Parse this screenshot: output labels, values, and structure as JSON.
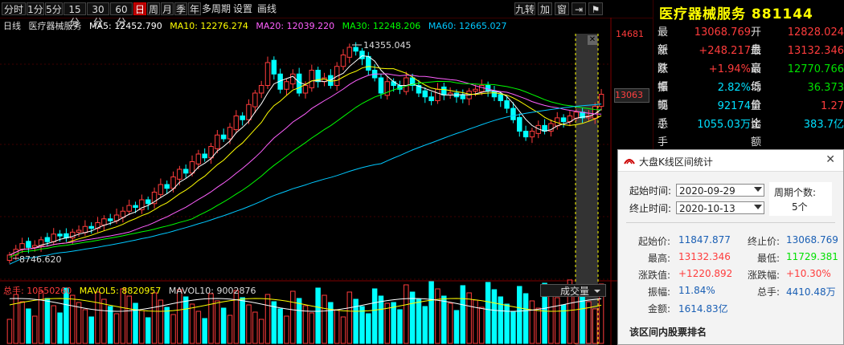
{
  "toolbar": {
    "periods": [
      "分时",
      "1分",
      "5分",
      "15分",
      "30分",
      "60分",
      "日",
      "周",
      "月",
      "季",
      "年",
      "多周期",
      "设置",
      "画线"
    ],
    "active": "日",
    "right_buttons": [
      "九转",
      "加",
      "窗",
      "⇥",
      "⚑"
    ]
  },
  "chart": {
    "ma_header": {
      "label": "日线",
      "name": "医疗器械服务",
      "ma5": "MA5: 12452.790",
      "ma10": "MA10: 12276.274",
      "ma20": "MA20: 12039.220",
      "ma30": "MA30: 12248.206",
      "ma60": "MA60: 12665.027"
    },
    "high_label": "14355.045",
    "low_label": "8746.620",
    "axis_top": "14681",
    "current_price": "13063",
    "vol_header": {
      "total": "总手: 10550260",
      "mavol5": "MAVOL5: 8820957",
      "mavol10": "MAVOL10: 9002876"
    },
    "turnover_tab": "成交量",
    "colors": {
      "ma5": "#ffffff",
      "ma10": "#ffff00",
      "ma20": "#ff60ff",
      "ma30": "#00ff00",
      "ma60": "#00c8ff",
      "up": "#ff3c3c",
      "down": "#00ffff"
    }
  },
  "chart_data": {
    "type": "candlestick",
    "closes": [
      8850,
      9000,
      9150,
      9050,
      9100,
      9250,
      9200,
      9400,
      9350,
      9300,
      9450,
      9500,
      9600,
      9550,
      9700,
      9800,
      9750,
      9900,
      10000,
      10150,
      10100,
      10300,
      10200,
      10500,
      10700,
      10600,
      10900,
      11100,
      11000,
      11300,
      11500,
      11400,
      11700,
      12000,
      11900,
      12200,
      12500,
      12400,
      12800,
      13100,
      13300,
      13900,
      13600,
      13200,
      13400,
      13600,
      13100,
      13300,
      13700,
      13400,
      13500,
      13300,
      13800,
      14100,
      14300,
      14200,
      14000,
      13700,
      13500,
      13100,
      13400,
      13300,
      13200,
      13500,
      13300,
      13100,
      13000,
      12900,
      13200,
      13050,
      13100,
      13000,
      12950,
      13150,
      13200,
      13300,
      13150,
      13000,
      12900,
      12700,
      12400,
      12100,
      11950,
      12100,
      12250,
      12100,
      12300,
      12450,
      12350,
      12500,
      12600,
      12450,
      12500,
      12750,
      13069
    ],
    "high": "14355.045",
    "low": "8746.620"
  },
  "quote": {
    "title": "医疗器械服务 881144",
    "rows": [
      {
        "l1": "最新",
        "v1": "13068.769",
        "c1": "red",
        "l2": "开盘",
        "v2": "12828.024",
        "c2": "red"
      },
      {
        "l1": "涨跌",
        "v1": "+248.217",
        "c1": "red",
        "l2": "最高",
        "v2": "13132.346",
        "c2": "red"
      },
      {
        "l1": "涨幅",
        "v1": "+1.94%",
        "c1": "red",
        "l2": "最低",
        "v2": "12770.766",
        "c2": "green"
      },
      {
        "l1": "振幅",
        "v1": "2.82%",
        "c1": "cyan",
        "l2": "均价",
        "v2": "36.373",
        "c2": "green"
      },
      {
        "l1": "现手",
        "v1": "92174",
        "c1": "cyan",
        "l2": "量比",
        "v2": "1.27",
        "c2": "red"
      },
      {
        "l1": "总手",
        "v1": "1055.03万",
        "c1": "cyan",
        "l2": "金额",
        "v2": "383.7亿",
        "c2": "cyan"
      }
    ]
  },
  "dialog": {
    "title": "大盘K线区间统计",
    "start_label": "起始时间:",
    "start_value": "2020-09-29",
    "end_label": "终止时间:",
    "end_value": "2020-10-13",
    "period_label": "周期个数:",
    "period_value": "5个",
    "stats": [
      {
        "l": "起始价:",
        "v": "11847.877",
        "c": "blue",
        "l2": "终止价:",
        "v2": "13068.769",
        "c2": "blue"
      },
      {
        "l": "最高:",
        "v": "13132.346",
        "c": "red",
        "l2": "最低:",
        "v2": "11729.381",
        "c2": "green"
      },
      {
        "l": "涨跌值:",
        "v": "+1220.892",
        "c": "red",
        "l2": "涨跌幅:",
        "v2": "+10.30%",
        "c2": "red"
      },
      {
        "l": "振幅:",
        "v": "11.84%",
        "c": "blue",
        "l2": "总手:",
        "v2": "4410.48万",
        "c2": "blue"
      },
      {
        "l": "金额:",
        "v": "1614.83亿",
        "c": "blue",
        "l2": "",
        "v2": "",
        "c2": ""
      }
    ],
    "section": "该区间内股票排名"
  }
}
